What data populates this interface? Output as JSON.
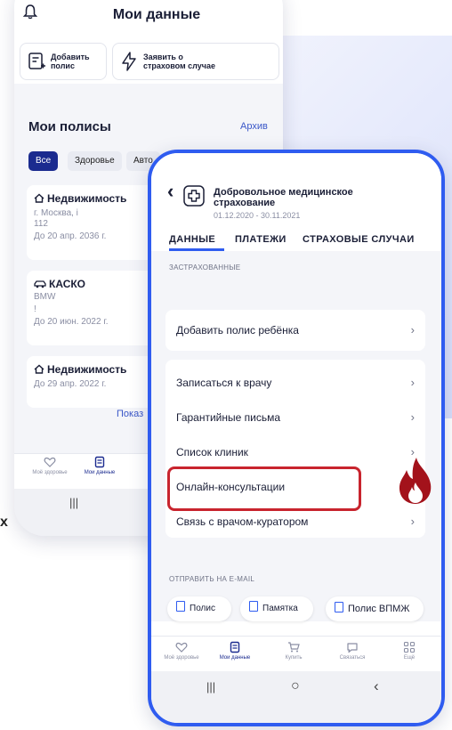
{
  "back_screen": {
    "header": {
      "title": "Мои данные"
    },
    "actions": [
      {
        "label": "Добавить\nполис",
        "icon": "add-document-icon"
      },
      {
        "label": "Заявить о\nстраховом случае",
        "icon": "lightning-icon"
      }
    ],
    "policies": {
      "title": "Мои полисы",
      "archive_label": "Архив",
      "filters": [
        "Все",
        "Здоровье",
        "Авто"
      ],
      "items": [
        {
          "icon": "house-icon",
          "title": "Недвижимость",
          "lines": [
            "г. Москва, і",
            "112"
          ],
          "until": "До 20 апр. 2036 г."
        },
        {
          "icon": "car-icon",
          "title": "КАСКО",
          "lines": [
            "BMW",
            "!"
          ],
          "until": "До 20 июн. 2022 г."
        },
        {
          "icon": "house-icon",
          "title": "Недвижимость",
          "lines": [],
          "until": "До 29 апр. 2022 г."
        }
      ],
      "show_more": "Показ"
    },
    "bottom_nav": [
      {
        "label": "Моё здоровье",
        "icon": "heart-icon"
      },
      {
        "label": "Мои данные",
        "icon": "document-icon"
      }
    ],
    "system_nav": {
      "recents": "|||"
    },
    "cut_text": "х"
  },
  "front_screen": {
    "header": {
      "title": "Добровольное медицинское страхование",
      "dates": "01.12.2020 - 30.11.2021",
      "back": "‹",
      "icon": "medical-cross-icon"
    },
    "tabs": [
      "ДАННЫЕ",
      "ПЛАТЕЖИ",
      "СТРАХОВЫЕ СЛУЧАИ"
    ],
    "active_tab": "ДАННЫЕ",
    "insured_section": "ЗАСТРАХОВАННЫЕ",
    "add_child": "Добавить полис ребёнка",
    "services": [
      "Записаться к врачу",
      "Гарантийные письма",
      "Список клиник",
      "Онлайн-консультации",
      "Связь с врачом-куратором"
    ],
    "highlighted_item": "Онлайн-консультации",
    "email_section": "ОТПРАВИТЬ НА E-MAIL",
    "email_buttons": [
      "Полис",
      "Памятка",
      "Полис ВПМЖ"
    ],
    "bottom_nav": [
      {
        "label": "Моё здоровье",
        "icon": "heart-icon"
      },
      {
        "label": "Мои данные",
        "icon": "document-icon"
      },
      {
        "label": "Купить",
        "icon": "cart-icon"
      },
      {
        "label": "Связаться",
        "icon": "chat-icon"
      },
      {
        "label": "Ещё",
        "icon": "grid-icon"
      }
    ],
    "system_nav": {
      "recents": "|||",
      "home": "○",
      "back": "‹"
    },
    "chevron": "›"
  },
  "colors": {
    "accent": "#2f5cf0",
    "highlight": "#c8242e",
    "fire": "#a3121b",
    "navy": "#1b2b8f"
  }
}
